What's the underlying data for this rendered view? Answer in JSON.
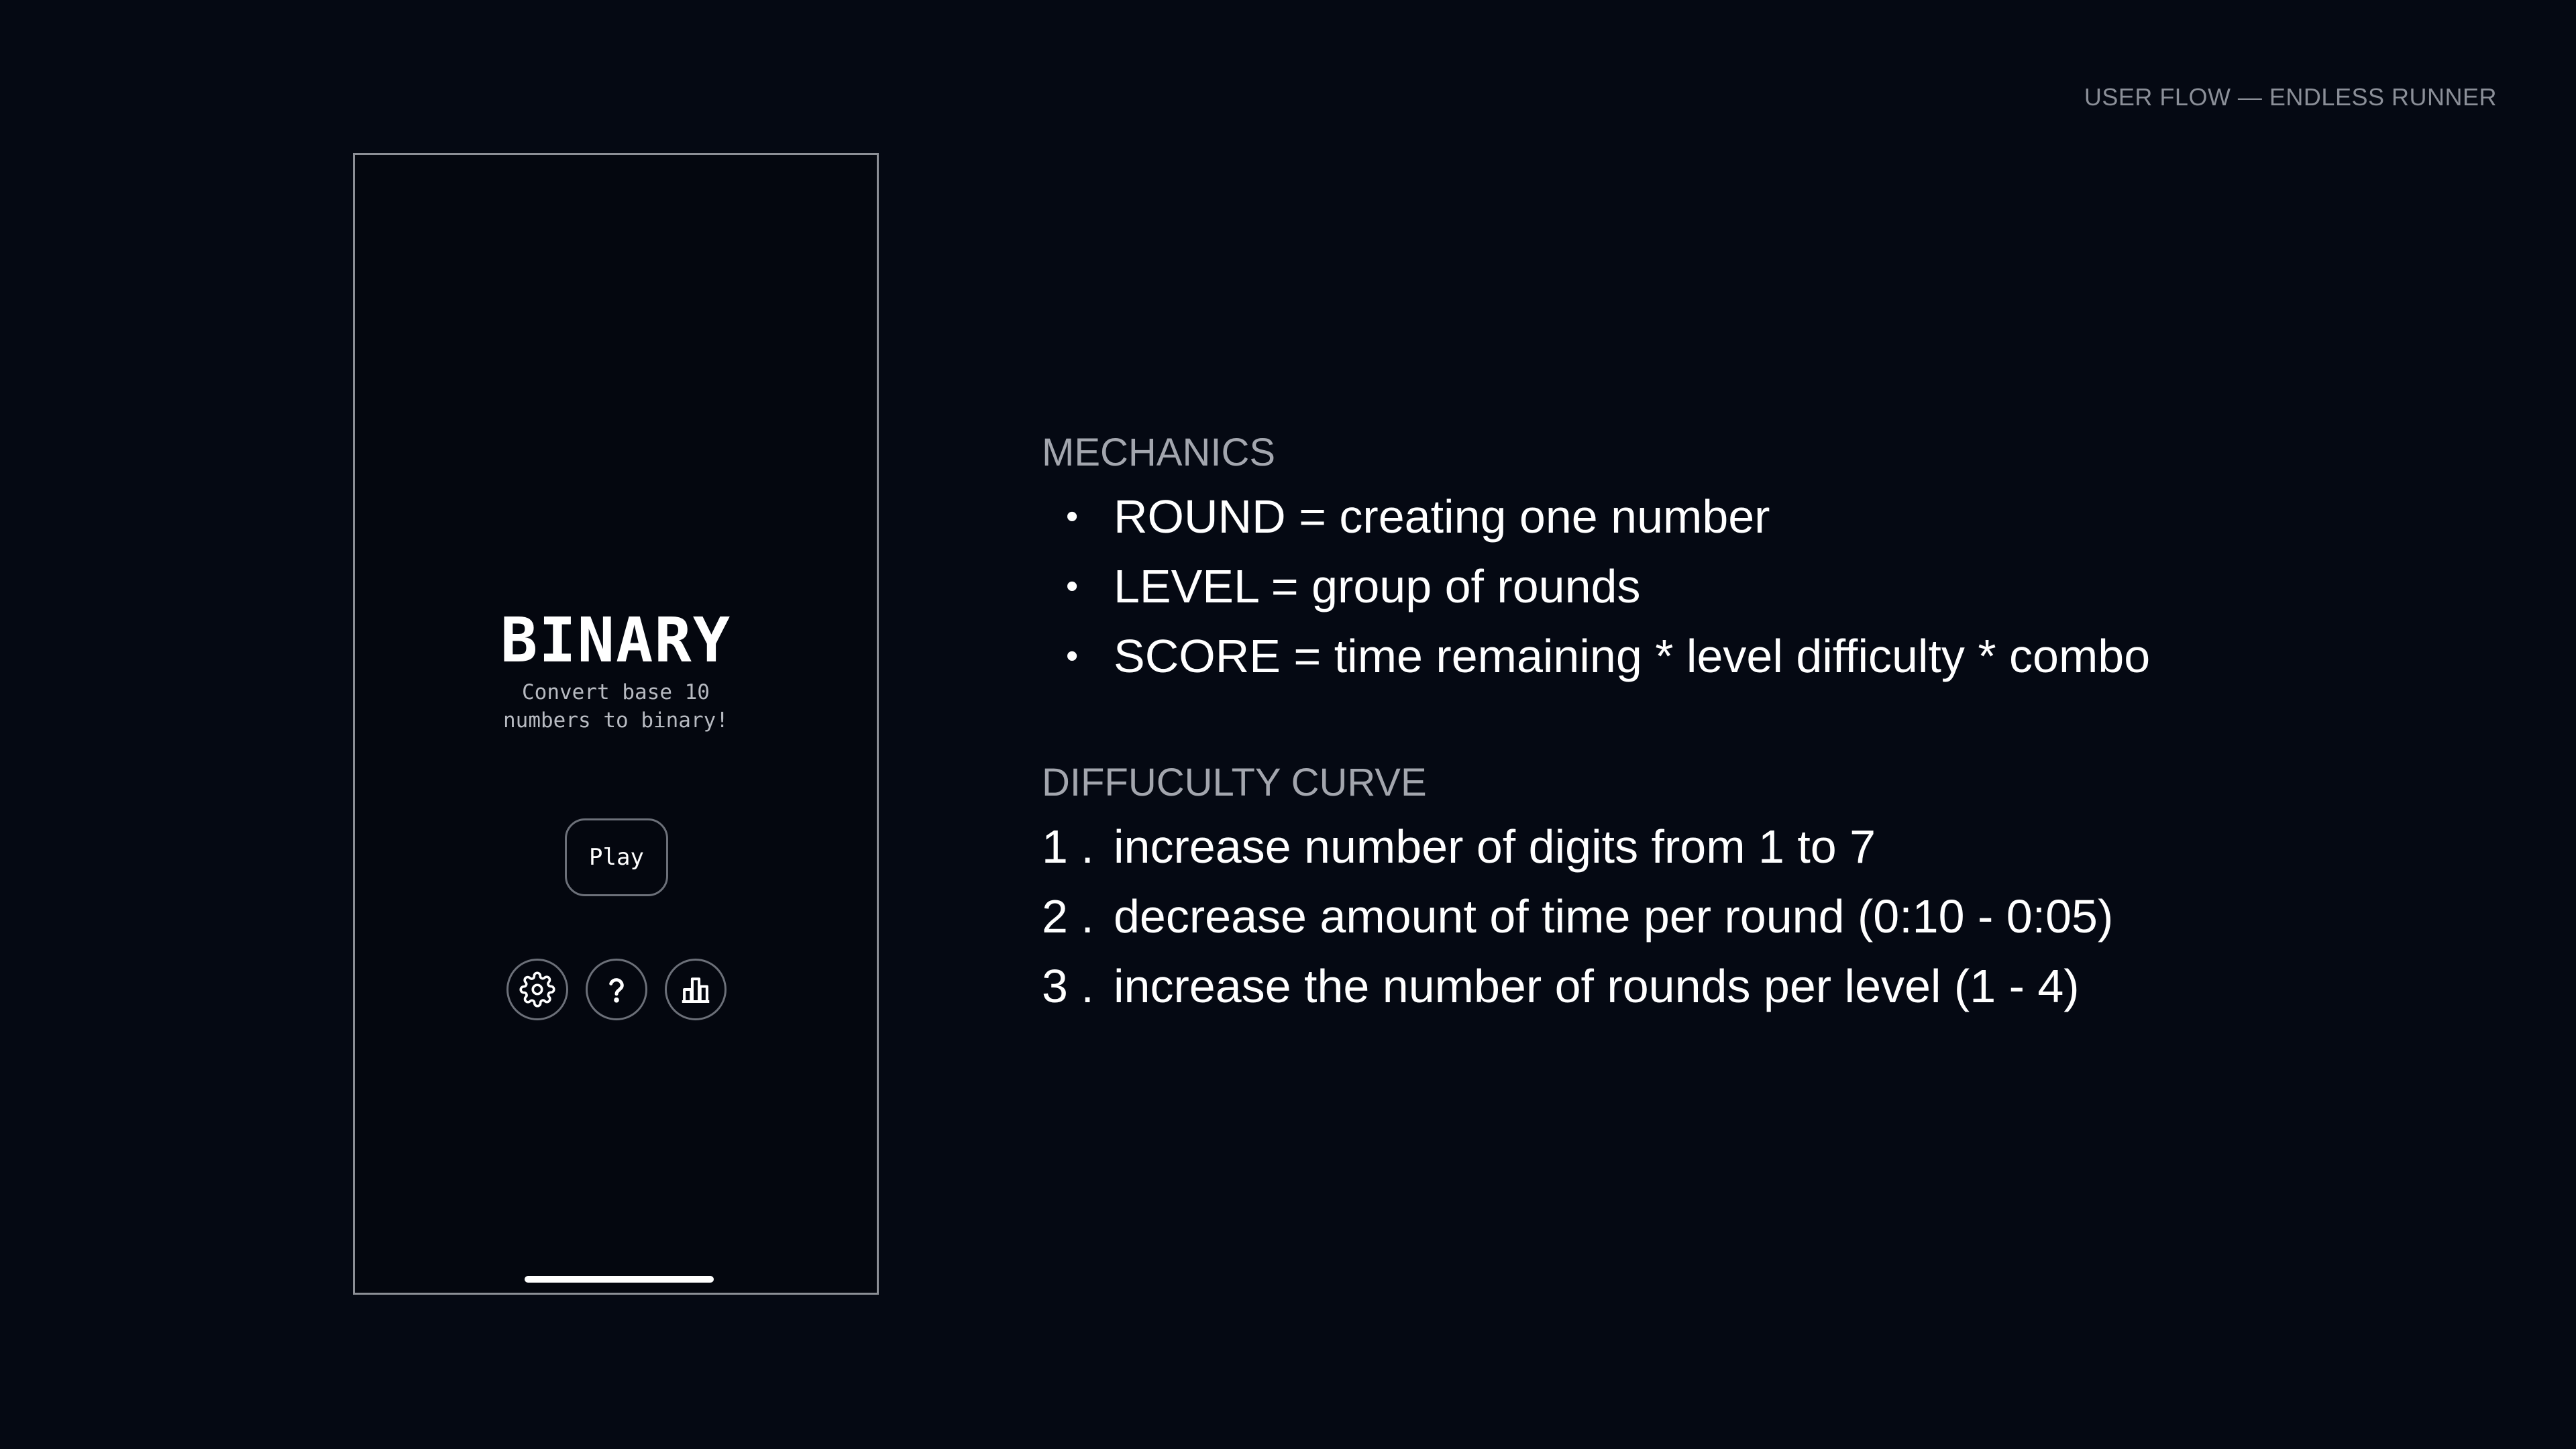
{
  "header": {
    "label": "USER FLOW — ENDLESS RUNNER"
  },
  "phone": {
    "title": "BINARY",
    "subtitle_line1": "Convert base 10",
    "subtitle_line2": "numbers to binary!",
    "play_label": "Play",
    "icons": [
      "gear-icon",
      "question-icon",
      "bar-chart-icon"
    ]
  },
  "mechanics": {
    "heading": "MECHANICS",
    "items": [
      "ROUND = creating one number",
      "LEVEL = group of rounds",
      "SCORE = time remaining * level difficulty * combo"
    ]
  },
  "difficulty": {
    "heading": "DIFFUCULTY CURVE",
    "items": [
      {
        "marker": "1 .",
        "text": "increase number of digits from 1 to 7"
      },
      {
        "marker": "2 .",
        "text": "decrease amount of time per round (0:10 - 0:05)"
      },
      {
        "marker": "3 .",
        "text": "increase the number of rounds per level (1 - 4)"
      }
    ]
  },
  "colors": {
    "background": "#050913",
    "phone_border": "#8c8f96",
    "heading_gray": "#a3a6ae",
    "text": "#ffffff"
  }
}
